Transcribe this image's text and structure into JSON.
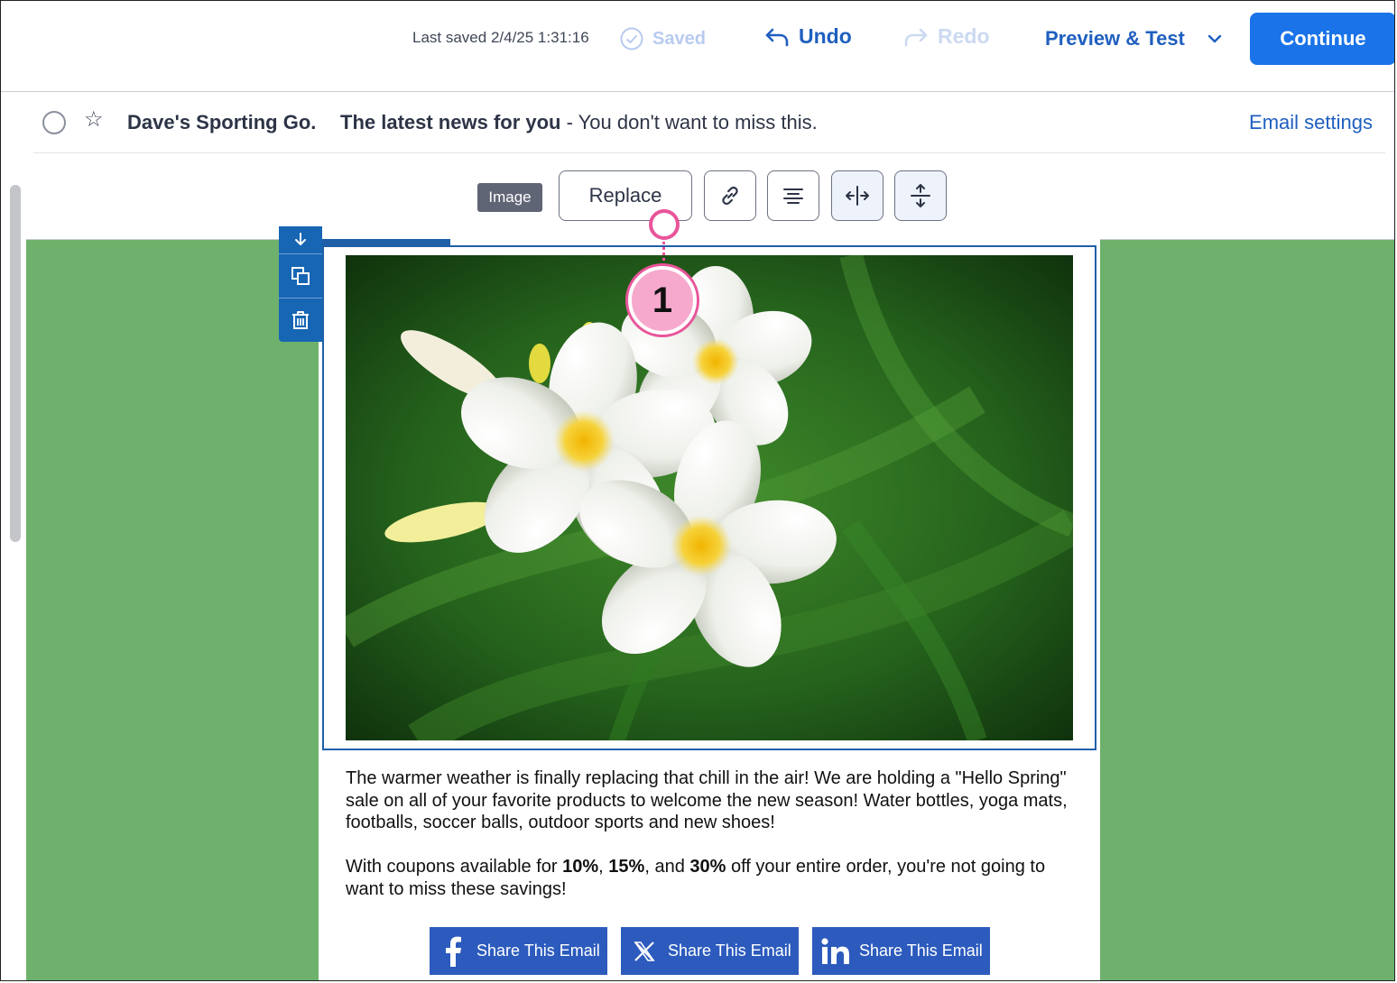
{
  "topbar": {
    "last_saved": "Last saved 2/4/25 1:31:16",
    "saved": "Saved",
    "undo": "Undo",
    "redo": "Redo",
    "preview": "Preview & Test",
    "continue": "Continue"
  },
  "subject_row": {
    "from": "Dave's Sporting Go.",
    "subject": "The latest news for you",
    "separator": " - ",
    "preheader": "You don't want to miss this.",
    "email_settings": "Email settings"
  },
  "toolbar": {
    "tag": "Image",
    "replace": "Replace"
  },
  "callout": {
    "number": "1"
  },
  "body": {
    "paragraph1": "The warmer weather is finally replacing that chill in the air! We are holding a \"Hello Spring\" sale on all of your favorite products to welcome the new season! Water bottles, yoga mats, footballs, soccer balls, outdoor sports and new shoes!",
    "p2_a": "With coupons available for ",
    "p2_b": "10%",
    "p2_c": ", ",
    "p2_d": "15%",
    "p2_e": ", and ",
    "p2_f": "30%",
    "p2_g": " off your entire order, you're not going to want to miss these savings!"
  },
  "share_buttons": [
    {
      "label": "Share This Email",
      "icon": "facebook-icon"
    },
    {
      "label": "Share This Email",
      "icon": "x-icon"
    },
    {
      "label": "Share This Email",
      "icon": "linkedin-icon"
    }
  ],
  "colors": {
    "accent": "#1a73e8",
    "link": "#1f5fbf",
    "canvas_bg": "#6eb16c",
    "share_bg": "#2c5bbd",
    "callout": "#e8559a"
  }
}
